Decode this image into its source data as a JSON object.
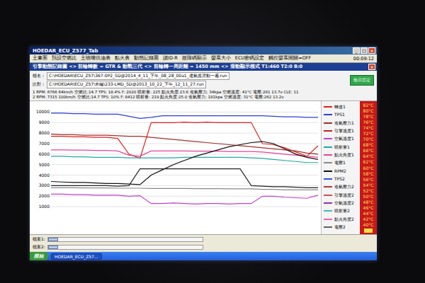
{
  "window": {
    "title": "HOEDAR_ECU_Z577_Tab",
    "controls": [
      "_",
      "□",
      "×"
    ]
  },
  "menu": {
    "items": [
      "主畫面",
      "預設空燃比",
      "主噴嘴供油表",
      "點火表",
      "動態記錄圖",
      "讀ID-R",
      "故障碼顯示",
      "螢幕大小",
      "ECU密碼設定",
      "觸控螢幕開關=OFF"
    ],
    "clock": "00:09:12"
  },
  "panel": {
    "title": "引擎動態記錄圖 <> 前輪轉數 = GTR & 動戰三代 <> 前輪轉一周距離 = 1450 mm <> 滑動顯示模式 T1:460 T2:0 B:0",
    "close": "×"
  },
  "files": [
    {
      "label": "檔名：",
      "path": "C:\\HOEDAR\\ECU_Z57\\367-0P2_SD@2014_4_11_下午_08_28_00a1_連氣搖背動一遍.run"
    },
    {
      "label": "比對：",
      "path": "C:\\HOEDAR\\ECU_Z57\\未編\\233-LMD_SD@2013_10_22_下午_12_11_27.run"
    }
  ],
  "settings_button": "檢示設定",
  "readouts": [
    "1 RPM: 6766  64km/h 空燃比:14.7  TPS: 18.4%  F: 2020 噴射量: 225 點火角度:23.6 進氣壓力: 34kpa 空燃溫度: 41°C 電壓:281 13.7v CLE: 11",
    "2 RPM: 7315  100km/h 空燃比:14.7  TPS: 10%  F: 8412 噴射量: 219 點火角度:25.0 進氣壓力: 181kpa 空燃溫度: 31°C 電壓:262 13.2v"
  ],
  "chart": {
    "y_ticks": [
      "10000",
      "9000",
      "8000",
      "7000",
      "6000",
      "5000",
      "4000",
      "3000",
      "2000",
      "1000"
    ],
    "series": [
      {
        "name": "blue",
        "color": "#2b3fd6",
        "values": [
          9900,
          9900,
          9850,
          9850,
          9800,
          9800,
          9800,
          9600,
          9400,
          9500,
          9650,
          9650,
          9650,
          9650,
          9650,
          9650,
          9650,
          9650,
          9650,
          9650,
          9600,
          9550,
          9550,
          9500,
          9500
        ]
      },
      {
        "name": "red",
        "color": "#e0201c",
        "values": [
          7700,
          7700,
          7650,
          7650,
          7600,
          7600,
          7500,
          6000,
          5600,
          9000,
          9000,
          9000,
          9050,
          9000,
          9050,
          9000,
          9000,
          9000,
          9000,
          7000,
          6900,
          6600,
          6200,
          5800,
          6800
        ]
      },
      {
        "name": "maroon",
        "color": "#a0302a",
        "values": [
          7900,
          7850,
          7850,
          7800,
          7800,
          7800,
          7750,
          7700,
          7700,
          7600,
          7500,
          7400,
          7300,
          7200,
          7100,
          7000,
          6900,
          6800,
          6700,
          6600,
          6500,
          6400,
          6300,
          6100,
          6000
        ]
      },
      {
        "name": "pink",
        "color": "#e8409a",
        "values": [
          6400,
          6400,
          6380,
          6380,
          6350,
          6350,
          6300,
          5900,
          5800,
          6300,
          6300,
          6300,
          6300,
          6280,
          6280,
          6280,
          6250,
          6250,
          6250,
          6200,
          6100,
          6000,
          5900,
          5800,
          5700
        ]
      },
      {
        "name": "teal",
        "color": "#20a8a0",
        "values": [
          5800,
          5800,
          5750,
          5750,
          5700,
          5700,
          5700,
          5650,
          5650,
          5650,
          5650,
          5650,
          5700,
          5700,
          5700,
          5700,
          5700,
          5700,
          5650,
          5600,
          5500,
          5400,
          5300,
          5200,
          5200
        ]
      },
      {
        "name": "rpm1",
        "color": "#111111",
        "values": [
          3400,
          3350,
          3300,
          3300,
          3250,
          3200,
          3200,
          3150,
          3100,
          4000,
          4500,
          5000,
          5400,
          5800,
          6100,
          6400,
          6700,
          6900,
          7100,
          7200,
          7000,
          6500,
          6000,
          5700,
          5500
        ]
      },
      {
        "name": "rpm2",
        "color": "#222222",
        "values": [
          3000,
          3000,
          3000,
          3000,
          3000,
          3000,
          2950,
          3000,
          4600,
          4600,
          4600,
          4600,
          4600,
          4600,
          4600,
          4600,
          4600,
          4600,
          3000,
          2950,
          2900,
          2900,
          2850,
          2800,
          2800
        ]
      },
      {
        "name": "gray",
        "color": "#8a8a8a",
        "values": [
          2800,
          2800,
          2800,
          2780,
          2780,
          2780,
          2760,
          2760,
          2760,
          2740,
          2740,
          2740,
          2740,
          2720,
          2720,
          2720,
          2700,
          2700,
          2700,
          2650,
          2650,
          2600,
          2600,
          2600,
          2600
        ]
      },
      {
        "name": "purple",
        "color": "#c040d0",
        "values": [
          2200,
          2200,
          2150,
          2150,
          2100,
          2100,
          2100,
          2000,
          2050,
          1300,
          1300,
          1350,
          1300,
          1250,
          1300,
          1300,
          1250,
          1300,
          1300,
          2000,
          2000,
          1900,
          1850,
          1800,
          2100
        ]
      }
    ]
  },
  "legend": [
    {
      "label": "轉速1",
      "color": "#e0201c"
    },
    {
      "label": "TPS1",
      "color": "#2b3fd6"
    },
    {
      "label": "進氣壓力1",
      "color": "#a0302a"
    },
    {
      "label": "引擎溫度1",
      "color": "#c02020"
    },
    {
      "label": "空氣溫度1",
      "color": "#c040d0"
    },
    {
      "label": "噴射量1",
      "color": "#20a8a0"
    },
    {
      "label": "點火角度1",
      "color": "#e8409a"
    },
    {
      "label": "電壓1",
      "color": "#8a8a8a"
    },
    {
      "label": "RPM2",
      "color": "#111111"
    },
    {
      "label": "TPS2",
      "color": "#3050e0"
    },
    {
      "label": "進氣壓力2",
      "color": "#b03838"
    },
    {
      "label": "引擎溫度2",
      "color": "#d05050"
    },
    {
      "label": "空氣溫度2",
      "color": "#9030b0"
    },
    {
      "label": "噴射量2",
      "color": "#40b8b0"
    },
    {
      "label": "點火角度2",
      "color": "#f060b0"
    },
    {
      "label": "電壓2",
      "color": "#606060"
    }
  ],
  "gauge": {
    "ticks": [
      "82°C",
      "80°C",
      "78°C",
      "76°C",
      "74°C",
      "72°C",
      "70°C",
      "68°C",
      "66°C",
      "64°C",
      "62°C",
      "60°C",
      "58°C",
      "56°C",
      "54°C",
      "52°C",
      "50°C",
      "48°C",
      "46°C",
      "44°C",
      "42°C",
      "40°C"
    ]
  },
  "scrollers": [
    {
      "label": "檔案1:",
      "level": 0
    },
    {
      "label": "檔案2:",
      "level": 0
    }
  ],
  "taskbar": {
    "start": "開始",
    "tasks": [
      "HOEDAR_ECU_Z57..."
    ]
  }
}
